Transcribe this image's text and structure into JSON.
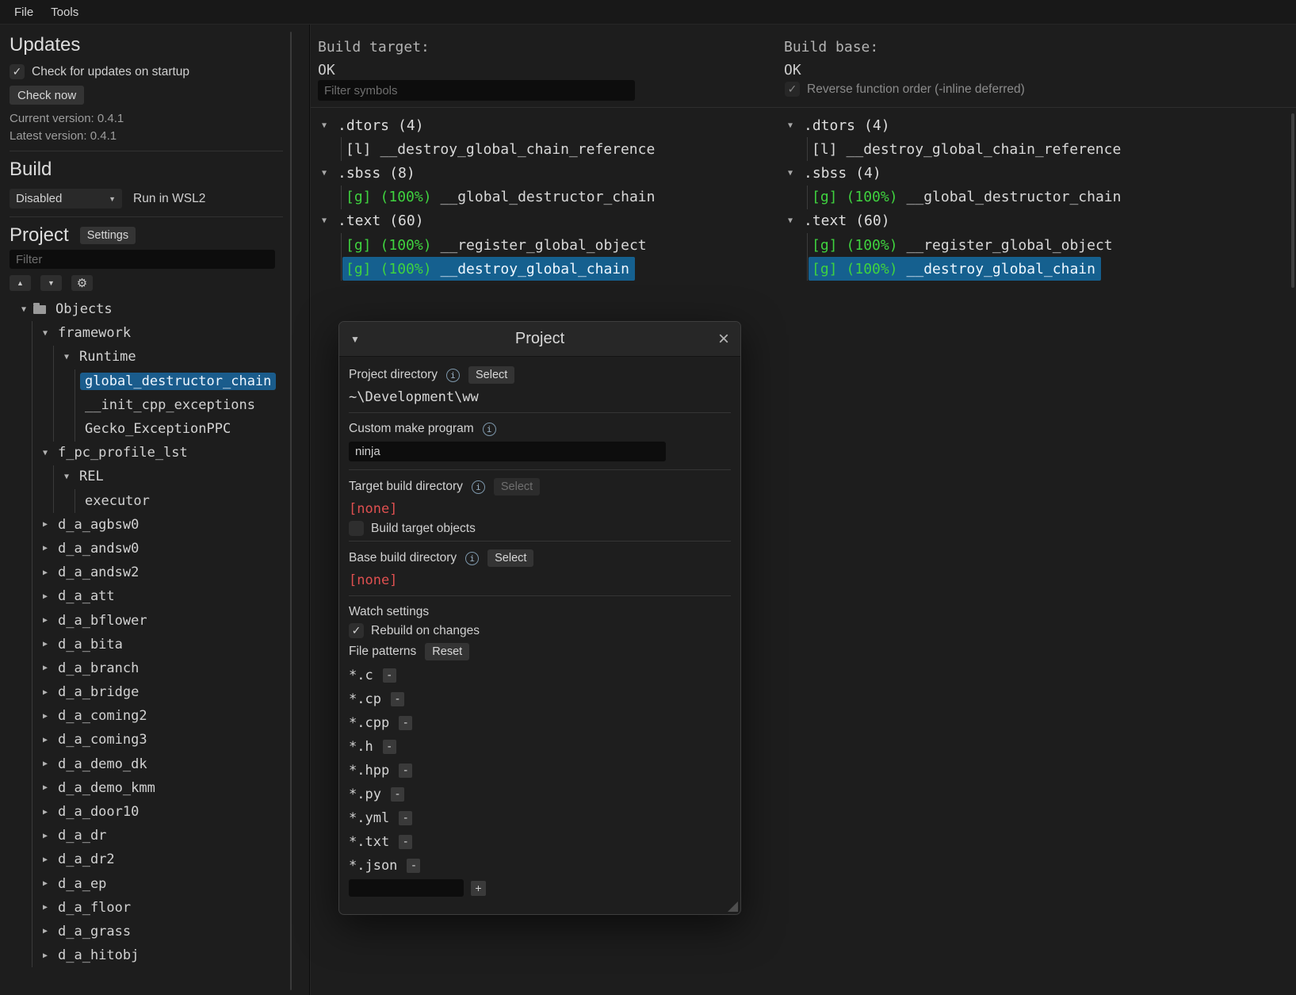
{
  "icons": {
    "triangle_down": "▼",
    "triangle_right": "▶",
    "check": "✓",
    "gear": "⚙",
    "up": "▲",
    "down": "▼",
    "close": "×",
    "info": "i",
    "dropdown": "▼"
  },
  "menu": {
    "file": "File",
    "tools": "Tools"
  },
  "sidebar": {
    "updates": {
      "title": "Updates",
      "check_on_startup_label": "Check for updates on startup",
      "check_now_label": "Check now",
      "current_version": "Current version: 0.4.1",
      "latest_version": "Latest version: 0.4.1"
    },
    "build": {
      "title": "Build",
      "mode": "Disabled",
      "wsl_label": "Run in WSL2"
    },
    "project": {
      "title": "Project",
      "settings_label": "Settings",
      "filter_placeholder": "Filter"
    },
    "tree": [
      {
        "label": "Objects",
        "level": 0,
        "state": "expanded"
      },
      {
        "label": "framework",
        "level": 1,
        "state": "expanded"
      },
      {
        "label": "Runtime",
        "level": 2,
        "state": "expanded"
      },
      {
        "label": "global_destructor_chain",
        "level": 3,
        "state": "leaf",
        "selected": true
      },
      {
        "label": "__init_cpp_exceptions",
        "level": 3,
        "state": "leaf"
      },
      {
        "label": "Gecko_ExceptionPPC",
        "level": 3,
        "state": "leaf"
      },
      {
        "label": "f_pc_profile_lst",
        "level": 1,
        "state": "expanded"
      },
      {
        "label": "REL",
        "level": 2,
        "state": "expanded"
      },
      {
        "label": "executor",
        "level": 3,
        "state": "leaf"
      },
      {
        "label": "d_a_agbsw0",
        "level": 1,
        "state": "collapsed"
      },
      {
        "label": "d_a_andsw0",
        "level": 1,
        "state": "collapsed"
      },
      {
        "label": "d_a_andsw2",
        "level": 1,
        "state": "collapsed"
      },
      {
        "label": "d_a_att",
        "level": 1,
        "state": "collapsed"
      },
      {
        "label": "d_a_bflower",
        "level": 1,
        "state": "collapsed"
      },
      {
        "label": "d_a_bita",
        "level": 1,
        "state": "collapsed"
      },
      {
        "label": "d_a_branch",
        "level": 1,
        "state": "collapsed"
      },
      {
        "label": "d_a_bridge",
        "level": 1,
        "state": "collapsed"
      },
      {
        "label": "d_a_coming2",
        "level": 1,
        "state": "collapsed"
      },
      {
        "label": "d_a_coming3",
        "level": 1,
        "state": "collapsed"
      },
      {
        "label": "d_a_demo_dk",
        "level": 1,
        "state": "collapsed"
      },
      {
        "label": "d_a_demo_kmm",
        "level": 1,
        "state": "collapsed"
      },
      {
        "label": "d_a_door10",
        "level": 1,
        "state": "collapsed"
      },
      {
        "label": "d_a_dr",
        "level": 1,
        "state": "collapsed"
      },
      {
        "label": "d_a_dr2",
        "level": 1,
        "state": "collapsed"
      },
      {
        "label": "d_a_ep",
        "level": 1,
        "state": "collapsed"
      },
      {
        "label": "d_a_floor",
        "level": 1,
        "state": "collapsed"
      },
      {
        "label": "d_a_grass",
        "level": 1,
        "state": "collapsed"
      },
      {
        "label": "d_a_hitobj",
        "level": 1,
        "state": "collapsed"
      }
    ]
  },
  "target": {
    "title": "Build target:",
    "status": "OK",
    "filter_placeholder": "Filter symbols",
    "sections": [
      {
        "name": ".dtors",
        "count": "(4)",
        "symbols": [
          {
            "flag": "[l]",
            "name": "__destroy_global_chain_reference"
          }
        ]
      },
      {
        "name": ".sbss",
        "count": "(8)",
        "symbols": [
          {
            "flag": "[g]",
            "match": "(100%)",
            "name": "__global_destructor_chain"
          }
        ]
      },
      {
        "name": ".text",
        "count": "(60)",
        "symbols": [
          {
            "flag": "[g]",
            "match": "(100%)",
            "name": "__register_global_object"
          },
          {
            "flag": "[g]",
            "match": "(100%)",
            "name": "__destroy_global_chain",
            "selected": true
          }
        ]
      }
    ]
  },
  "base": {
    "title": "Build base:",
    "status": "OK",
    "reverse_label": "Reverse function order (-inline deferred)",
    "sections": [
      {
        "name": ".dtors",
        "count": "(4)",
        "symbols": [
          {
            "flag": "[l]",
            "name": "__destroy_global_chain_reference"
          }
        ]
      },
      {
        "name": ".sbss",
        "count": "(4)",
        "symbols": [
          {
            "flag": "[g]",
            "match": "(100%)",
            "name": "__global_destructor_chain"
          }
        ]
      },
      {
        "name": ".text",
        "count": "(60)",
        "symbols": [
          {
            "flag": "[g]",
            "match": "(100%)",
            "name": "__register_global_object"
          },
          {
            "flag": "[g]",
            "match": "(100%)",
            "name": "__destroy_global_chain",
            "selected": true
          }
        ]
      }
    ]
  },
  "dialog": {
    "title": "Project",
    "project_dir_label": "Project directory",
    "select_label": "Select",
    "project_dir_value": "~\\Development\\ww",
    "make_label": "Custom make program",
    "make_value": "ninja",
    "target_dir_label": "Target build directory",
    "none_value": "[none]",
    "build_target_objects_label": "Build target objects",
    "base_dir_label": "Base build directory",
    "watch_title": "Watch settings",
    "rebuild_label": "Rebuild on changes",
    "file_patterns_label": "File patterns",
    "reset_label": "Reset",
    "patterns": [
      "*.c",
      "*.cp",
      "*.cpp",
      "*.h",
      "*.hpp",
      "*.py",
      "*.yml",
      "*.txt",
      "*.json"
    ],
    "remove_label": "-",
    "add_label": "+"
  }
}
